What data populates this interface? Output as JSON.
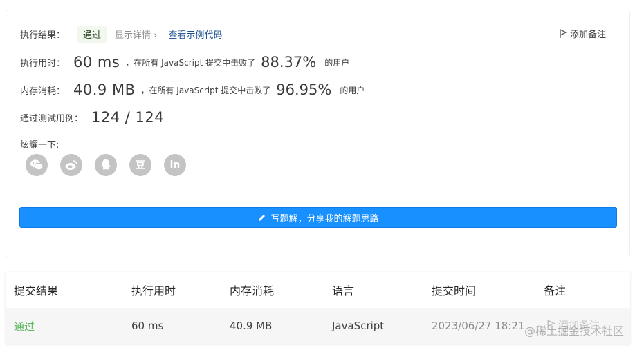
{
  "summary": {
    "result_label": "执行结果：",
    "result_badge": "通过",
    "show_details": "显示详情",
    "view_sample": "查看示例代码",
    "add_note": "添加备注",
    "runtime_label": "执行用时：",
    "runtime_value": "60 ms",
    "runtime_text": "，在所有 JavaScript 提交中击败了",
    "runtime_pct": "88.37%",
    "runtime_tail": "的用户",
    "memory_label": "内存消耗：",
    "memory_value": "40.9 MB",
    "memory_text": "，在所有 JavaScript 提交中击败了",
    "memory_pct": "96.95%",
    "memory_tail": "的用户",
    "tests_label": "通过测试用例：",
    "tests_value": "124 / 124",
    "share_label": "炫耀一下:",
    "share_icons": [
      "wechat-icon",
      "weibo-icon",
      "qq-icon",
      "douban-icon",
      "linkedin-icon"
    ],
    "linkedin_text": "in",
    "douban_text": "豆",
    "write_button": "写题解，分享我的解题思路"
  },
  "table": {
    "headers": [
      "提交结果",
      "执行用时",
      "内存消耗",
      "语言",
      "提交时间",
      "备注"
    ],
    "row": {
      "result": "通过",
      "runtime": "60 ms",
      "memory": "40.9 MB",
      "language": "JavaScript",
      "time": "2023/06/27 18:21",
      "note": "添加备注"
    }
  },
  "watermark": "@稀土掘金技术社区",
  "colors": {
    "accent": "#1890ff",
    "pass": "#5cb85c"
  }
}
